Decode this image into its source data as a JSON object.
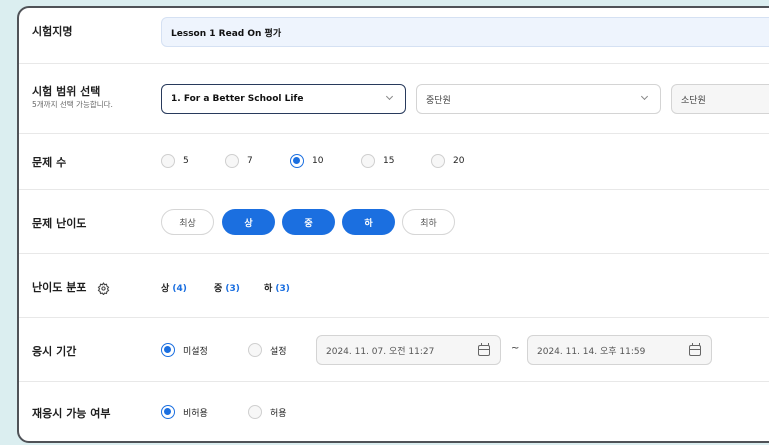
{
  "exam_name": {
    "label": "시험지명",
    "value": "Lesson 1 Read On 평가"
  },
  "exam_range": {
    "label": "시험 범위 선택",
    "hint": "5개까지 선택 가능합니다.",
    "unit": "1. For a Better School Life",
    "mid_unit_placeholder": "중단원",
    "small_unit_placeholder": "소단원"
  },
  "question_count": {
    "label": "문제 수",
    "options": [
      "5",
      "7",
      "10",
      "15",
      "20"
    ],
    "selected": "10"
  },
  "difficulty": {
    "label": "문제 난이도",
    "options": [
      "최상",
      "상",
      "중",
      "하",
      "최하"
    ],
    "selected": [
      "상",
      "중",
      "하"
    ]
  },
  "difficulty_distribution": {
    "label": "난이도 분포",
    "items": [
      {
        "name": "상",
        "count": "(4)"
      },
      {
        "name": "중",
        "count": "(3)"
      },
      {
        "name": "하",
        "count": "(3)"
      }
    ]
  },
  "exam_period": {
    "label": "응시 기간",
    "options": [
      "미설정",
      "설정"
    ],
    "selected": "미설정",
    "start": "2024. 11. 07. 오전 11:27",
    "separator": "~",
    "end": "2024. 11. 14. 오후 11:59"
  },
  "retake": {
    "label": "재응시 가능 여부",
    "options": [
      "비허용",
      "허용"
    ],
    "selected": "비허용"
  },
  "colors": {
    "accent": "#1b6fe0",
    "page_bg": "#dbeef0",
    "panel_border": "#4f5257"
  },
  "icons": {
    "settings": "gear-icon",
    "calendar": "calendar-icon",
    "dropdown": "chevron-down-icon"
  }
}
